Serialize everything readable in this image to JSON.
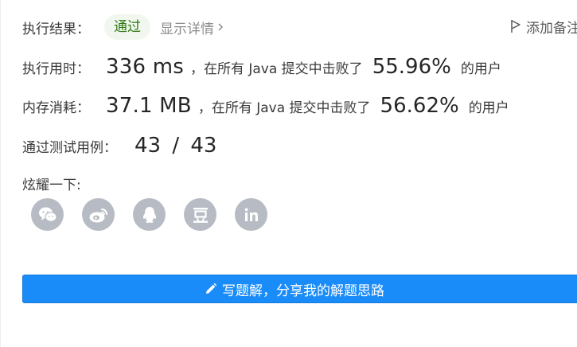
{
  "result": {
    "label": "执行结果：",
    "status": "通过",
    "details_link": "显示详情",
    "add_note": "添加备注"
  },
  "runtime": {
    "label": "执行用时：",
    "value": "336 ms",
    "sentence": "，在所有 Java 提交中击败了",
    "percent": "55.96%",
    "suffix": "的用户"
  },
  "memory": {
    "label": "内存消耗：",
    "value": "37.1 MB",
    "sentence": "，在所有 Java 提交中击败了",
    "percent": "56.62%",
    "suffix": "的用户"
  },
  "testcases": {
    "label": "通过测试用例：",
    "value": "43 / 43"
  },
  "share": {
    "label": "炫耀一下:",
    "icons": [
      "wechat-icon",
      "weibo-icon",
      "qq-icon",
      "douban-icon",
      "linkedin-icon"
    ]
  },
  "write_solution": {
    "label": "写题解，分享我的解题思路"
  },
  "colors": {
    "pass_text": "#2d7a12",
    "pass_bg": "#f1f7ee",
    "primary_button": "#1a8cf9",
    "share_icon_bg": "#b7bcc4"
  }
}
